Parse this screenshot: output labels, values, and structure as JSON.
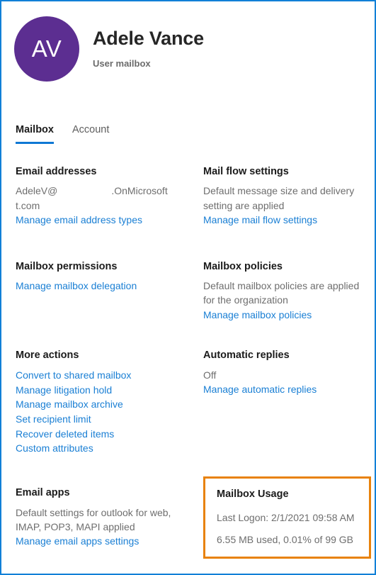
{
  "header": {
    "avatar_initials": "AV",
    "name": "Adele Vance",
    "subtitle": "User mailbox"
  },
  "tabs": [
    {
      "label": "Mailbox",
      "selected": true
    },
    {
      "label": "Account",
      "selected": false
    }
  ],
  "sections": {
    "email_addresses": {
      "title": "Email addresses",
      "value_prefix": "AdeleV@",
      "value_suffix": ".OnMicrosoft t.com",
      "link": "Manage email address types"
    },
    "mail_flow": {
      "title": "Mail flow settings",
      "desc": "Default message size and delivery setting are applied",
      "link": "Manage mail flow settings"
    },
    "mailbox_permissions": {
      "title": "Mailbox permissions",
      "link": "Manage mailbox delegation"
    },
    "mailbox_policies": {
      "title": "Mailbox policies",
      "desc": "Default mailbox policies are applied for the organization",
      "link": "Manage mailbox policies"
    },
    "more_actions": {
      "title": "More actions",
      "links": [
        "Convert to shared mailbox",
        "Manage litigation hold",
        "Manage mailbox archive",
        "Set recipient limit",
        "Recover deleted items",
        "Custom attributes"
      ]
    },
    "automatic_replies": {
      "title": "Automatic replies",
      "status": "Off",
      "link": "Manage automatic replies"
    },
    "email_apps": {
      "title": "Email apps",
      "desc": "Default settings for outlook for web, IMAP, POP3, MAPI applied",
      "link": "Manage email apps settings"
    },
    "mailbox_usage": {
      "title": "Mailbox Usage",
      "last_logon": "Last Logon: 2/1/2021 09:58 AM",
      "usage": "6.55 MB used, 0.01% of 99 GB",
      "highlight_color": "#e8820c"
    }
  },
  "colors": {
    "accent": "#0f78d4",
    "link": "#1a7fd4",
    "avatar": "#5c2e91",
    "highlight": "#e8820c",
    "panel_border": "#1180d7"
  }
}
